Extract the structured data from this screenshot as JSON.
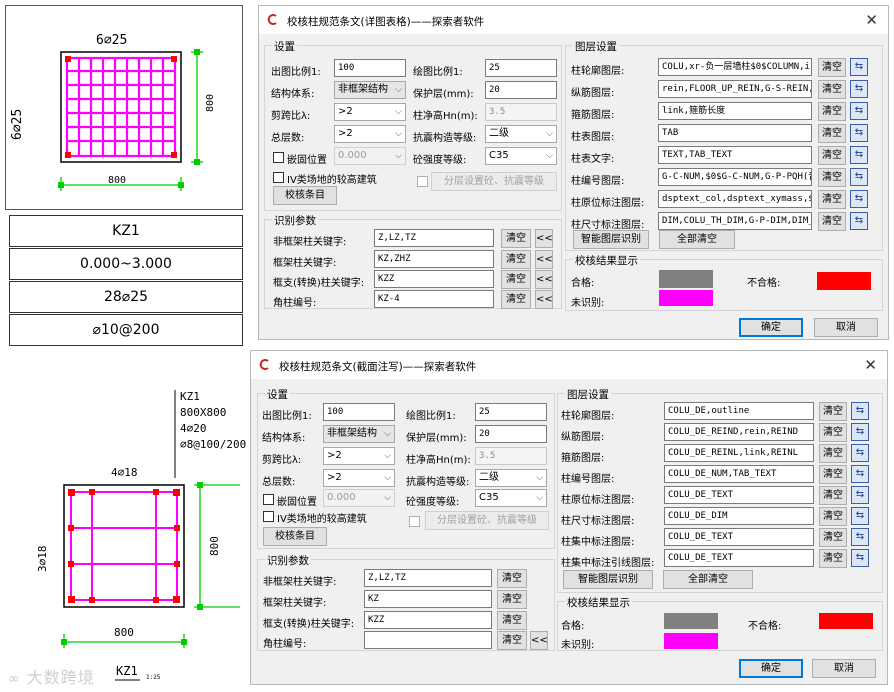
{
  "drawing_top": {
    "top_bar": "6⌀25",
    "left_bar": "6⌀25",
    "height_dim": "800",
    "width_dim": "800",
    "table": [
      "KZ1",
      "0.000~3.000",
      "28⌀25",
      "⌀10@200"
    ]
  },
  "drawing_bottom": {
    "col_name": "KZ1",
    "col_size": "800X800",
    "corner_bars": "4⌀20",
    "stirrup": "⌀8@100/200",
    "top_bar": "4⌀18",
    "left_bar": "3⌀18",
    "height_dim": "800",
    "width_dim": "800",
    "caption": "KZ1",
    "caption_scale": "1:25"
  },
  "watermark": "大数跨境",
  "colors": {
    "pass": "#808080",
    "fail": "#ff0000",
    "unrecognized": "#ff00ff",
    "column_outline": "#000000",
    "rebar": "#ff00ff",
    "dim": "#00cc00"
  },
  "dialog1": {
    "title": "校核柱规范条文(详图表格)——探索者软件",
    "close": "✕",
    "settings": {
      "legend": "设置",
      "out_scale_label": "出图比例1:",
      "out_scale": "100",
      "draw_scale_label": "绘图比例1:",
      "draw_scale": "25",
      "struct_label": "结构体系:",
      "struct": "非框架结构",
      "cover_label": "保护层(mm):",
      "cover": "20",
      "shear_label": "剪跨比λ:",
      "shear": ">2",
      "hn_label": "柱净高Hn(m):",
      "hn": "3.5",
      "floors_label": "总层数:",
      "floors": ">2",
      "seismic_label": "抗震构造等级:",
      "seismic": "二级",
      "embed_label": "嵌固位置",
      "embed_value": "0.000",
      "concrete_label": "砼强度等级:",
      "concrete": "C35",
      "iv_label": "IV类场地的较高建筑",
      "layer_set_btn": "分层设置砼、抗震等级",
      "check_btn": "校核条目"
    },
    "recog": {
      "legend": "识别参数",
      "rows": [
        {
          "label": "非框架柱关键字:",
          "value": "Z,LZ,TZ"
        },
        {
          "label": "框架柱关键字:",
          "value": "KZ,ZHZ"
        },
        {
          "label": "框支(转换)柱关键字:",
          "value": "KZZ"
        },
        {
          "label": "角柱编号:",
          "value": "KZ-4"
        }
      ],
      "clear": "清空",
      "pick": "<<"
    },
    "layers": {
      "legend": "图层设置",
      "rows": [
        {
          "label": "柱轮廓图层:",
          "value": "COLU,xr-负一层墙柱$0$COLUMN,i"
        },
        {
          "label": "纵筋图层:",
          "value": "rein,FLOOR_UP_REIN,G-S-REIN,("
        },
        {
          "label": "箍筋图层:",
          "value": "link,箍筋长度"
        },
        {
          "label": "柱表图层:",
          "value": "TAB"
        },
        {
          "label": "柱表文字:",
          "value": "TEXT,TAB_TEXT"
        },
        {
          "label": "柱编号图层:",
          "value": "G-C-NUM,$0$G-C-NUM,G-P-PQH(音"
        },
        {
          "label": "柱原位标注图层:",
          "value": "dsptext_col,dsptext_xymass,$("
        },
        {
          "label": "柱尺寸标注图层:",
          "value": "DIM,COLU_TH_DIM,G-P-DIM,DIM_!"
        }
      ],
      "clear": "清空",
      "pick": "⇆",
      "smart_btn": "智能图层识别",
      "clear_all_btn": "全部清空"
    },
    "result": {
      "legend": "校核结果显示",
      "pass": "合格:",
      "fail": "不合格:",
      "unrecog": "未识别:"
    },
    "ok": "确定",
    "cancel": "取消"
  },
  "dialog2": {
    "title": "校核柱规范条文(截面注写)——探索者软件",
    "close": "✕",
    "settings": {
      "legend": "设置",
      "out_scale_label": "出图比例1:",
      "out_scale": "100",
      "draw_scale_label": "绘图比例1:",
      "draw_scale": "25",
      "struct_label": "结构体系:",
      "struct": "非框架结构",
      "cover_label": "保护层(mm):",
      "cover": "20",
      "shear_label": "剪跨比λ:",
      "shear": ">2",
      "hn_label": "柱净高Hn(m):",
      "hn": "3.5",
      "floors_label": "总层数:",
      "floors": ">2",
      "seismic_label": "抗震构造等级:",
      "seismic": "二级",
      "embed_label": "嵌固位置",
      "embed_value": "0.000",
      "concrete_label": "砼强度等级:",
      "concrete": "C35",
      "iv_label": "IV类场地的较高建筑",
      "layer_set_btn": "分层设置砼、抗震等级",
      "check_btn": "校核条目"
    },
    "recog": {
      "legend": "识别参数",
      "rows": [
        {
          "label": "非框架柱关键字:",
          "value": "Z,LZ,TZ"
        },
        {
          "label": "框架柱关键字:",
          "value": "KZ"
        },
        {
          "label": "框支(转换)柱关键字:",
          "value": "KZZ"
        },
        {
          "label": "角柱编号:",
          "value": ""
        }
      ],
      "clear": "清空",
      "pick": "<<"
    },
    "layers": {
      "legend": "图层设置",
      "rows": [
        {
          "label": "柱轮廓图层:",
          "value": "COLU_DE,outline"
        },
        {
          "label": "纵筋图层:",
          "value": "COLU_DE_REIND,rein,REIND"
        },
        {
          "label": "箍筋图层:",
          "value": "COLU_DE_REINL,link,REINL"
        },
        {
          "label": "柱编号图层:",
          "value": "COLU_DE_NUM,TAB_TEXT"
        },
        {
          "label": "柱原位标注图层:",
          "value": "COLU_DE_TEXT"
        },
        {
          "label": "柱尺寸标注图层:",
          "value": "COLU_DE_DIM"
        },
        {
          "label": "柱集中标注图层:",
          "value": "COLU_DE_TEXT"
        },
        {
          "label": "柱集中标注引线图层:",
          "value": "COLU_DE_TEXT"
        }
      ],
      "clear": "清空",
      "pick": "⇆",
      "smart_btn": "智能图层识别",
      "clear_all_btn": "全部清空"
    },
    "result": {
      "legend": "校核结果显示",
      "pass": "合格:",
      "fail": "不合格:",
      "unrecog": "未识别:"
    },
    "ok": "确定",
    "cancel": "取消"
  }
}
